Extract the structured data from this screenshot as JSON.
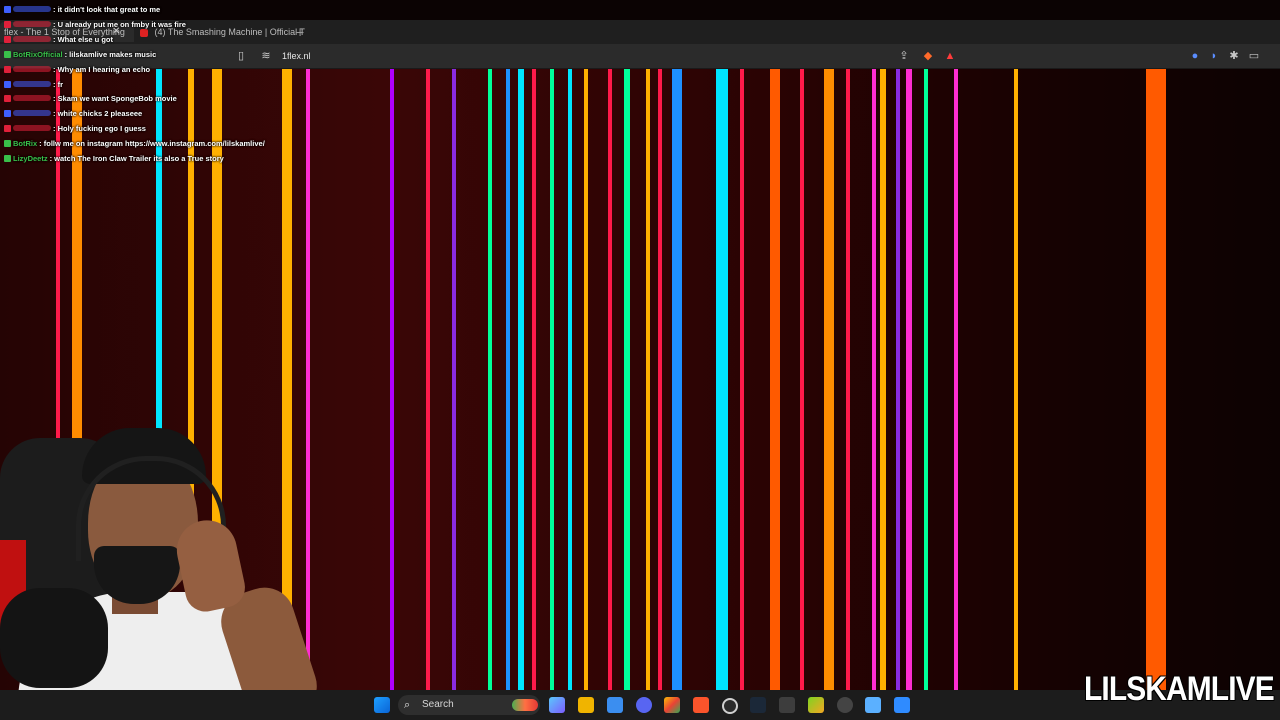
{
  "browser": {
    "tabs": [
      {
        "label": "flex - The 1 Stop of Everything"
      },
      {
        "label": "(4) The Smashing Machine | Official T"
      }
    ],
    "url": "1flex.nl"
  },
  "chat": [
    {
      "user": "",
      "user_color": "#3f5fff",
      "text": ": it didn't look that great to me"
    },
    {
      "user": "",
      "user_color": "#e0203a",
      "text": ": U already put me on fmby it was fire"
    },
    {
      "user": "",
      "user_color": "#e0203a",
      "text": ": What else u got"
    },
    {
      "user": "BotRixOfficial",
      "user_color": "#39c04a",
      "text": ": lilskamlive makes music"
    },
    {
      "user": "",
      "user_color": "#e0203a",
      "text": ": Why am I hearing an echo"
    },
    {
      "user": "",
      "user_color": "#3f5fff",
      "text": ": fr"
    },
    {
      "user": "",
      "user_color": "#e0203a",
      "text": ": Skam we want SpongeBob movie"
    },
    {
      "user": "",
      "user_color": "#3f5fff",
      "text": ": white chicks 2 pleaseee"
    },
    {
      "user": "",
      "user_color": "#e0203a",
      "text": ": Holy fucking ego I guess"
    },
    {
      "user": "BotRix",
      "user_color": "#39c04a",
      "text": ": follw me on instagram https://www.instagram.com/lilskamlive/"
    },
    {
      "user": "LizyDeetz",
      "user_color": "#39c04a",
      "text": ": watch The Iron Claw Trailer its also a True story"
    }
  ],
  "taskbar": {
    "search_label": "Search"
  },
  "watermark": "LILSKAMLIVE",
  "colors": {
    "stripes": [
      "#ffb000",
      "#ff8c00",
      "#ff1a4a",
      "#ff2dd1",
      "#8a2be2",
      "#b000ff",
      "#00e5ff",
      "#00ff99",
      "#1e90ff",
      "#ff2a00",
      "#ff5a00"
    ]
  }
}
